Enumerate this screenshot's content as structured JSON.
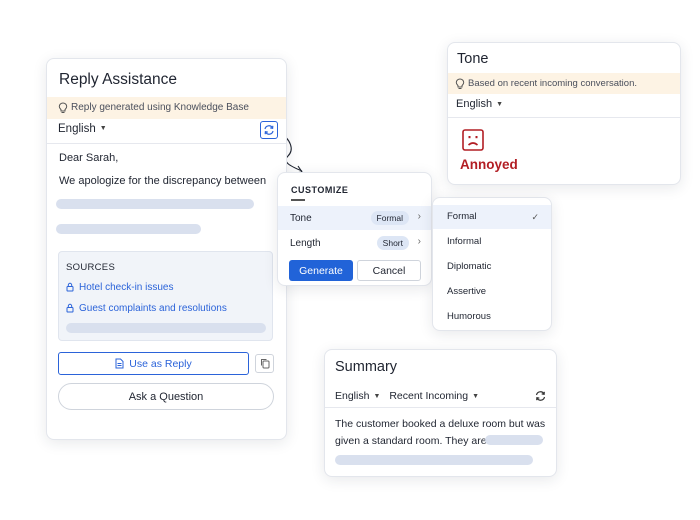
{
  "reply": {
    "title": "Reply Assistance",
    "kb_banner": "Reply generated using Knowledge Base",
    "language": "English",
    "greeting": "Dear Sarah,",
    "body": "We apologize for the discrepancy between",
    "sources": {
      "heading": "SOURCES",
      "items": [
        "Hotel check-in issues",
        "Guest complaints and resolutions"
      ]
    },
    "use_reply_label": "Use as Reply",
    "ask_label": "Ask a Question"
  },
  "customize": {
    "heading": "CUSTOMIZE",
    "tone_label": "Tone",
    "tone_value": "Formal",
    "length_label": "Length",
    "length_value": "Short",
    "generate_label": "Generate",
    "cancel_label": "Cancel"
  },
  "tone_options": {
    "items": [
      "Formal",
      "Informal",
      "Diplomatic",
      "Assertive",
      "Humorous"
    ],
    "selected": "Formal"
  },
  "tone": {
    "title": "Tone",
    "banner": "Based on recent incoming conversation.",
    "language": "English",
    "mood": "Annoyed",
    "mood_icon": "frown-face-icon"
  },
  "summary": {
    "title": "Summary",
    "language": "English",
    "scope": "Recent Incoming",
    "text": "The customer booked a deluxe room but was given a standard room. They are"
  },
  "colors": {
    "accent": "#2163d8",
    "banner_bg": "#fdf3e4",
    "mood": "#b21e24",
    "skeleton": "#d9e0ee"
  }
}
